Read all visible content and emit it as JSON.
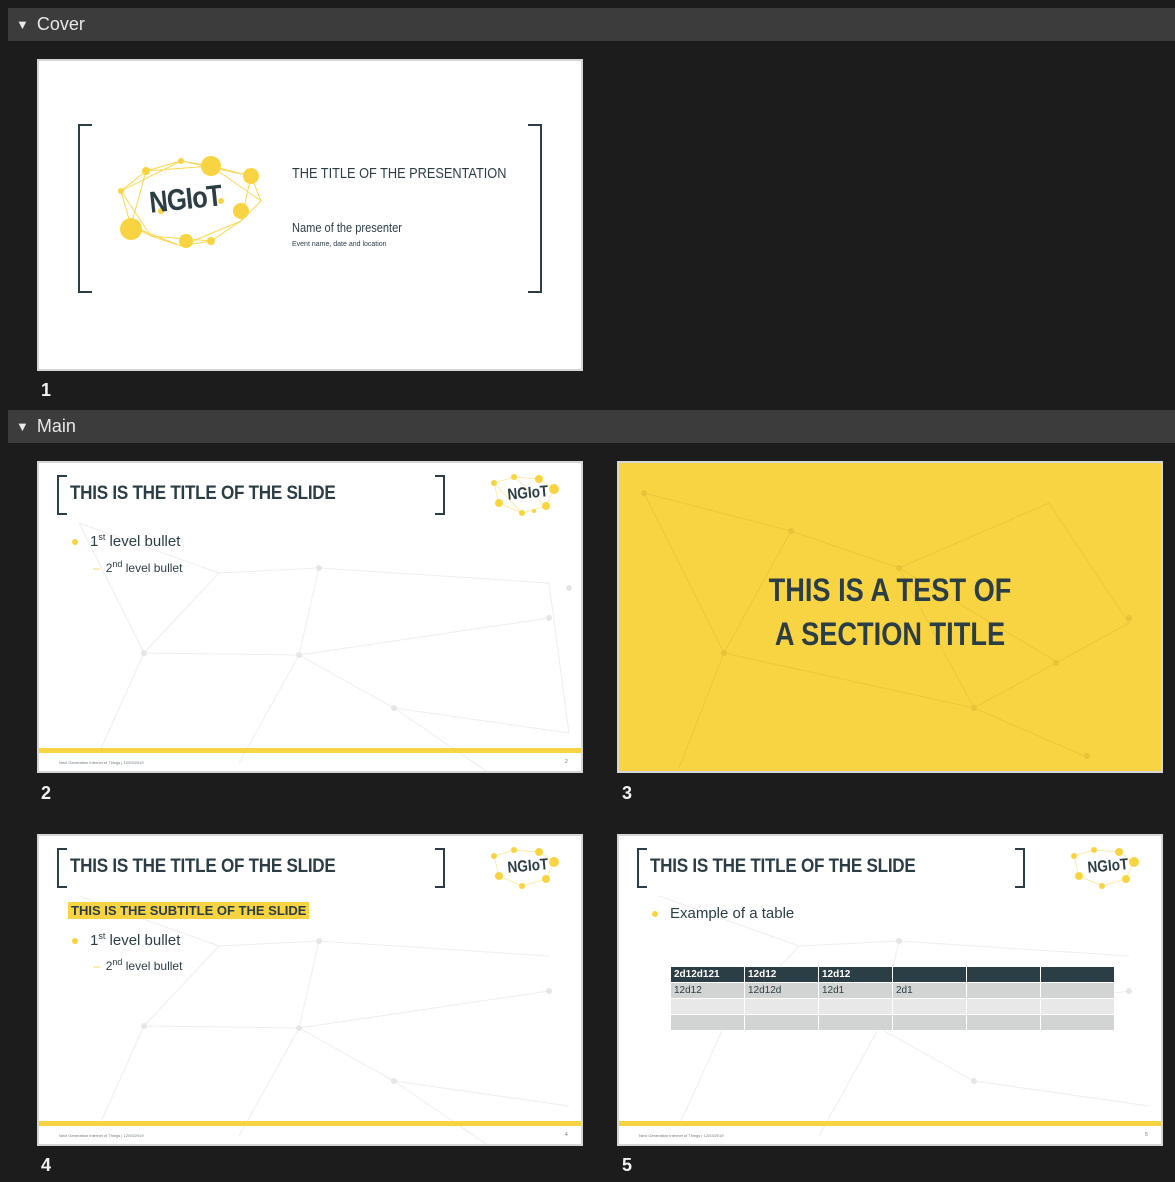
{
  "sections": [
    {
      "label": "Cover"
    },
    {
      "label": "Main"
    }
  ],
  "slides": [
    {
      "number": "1",
      "logo": "NGIoT",
      "title": "THE TITLE OF THE PRESENTATION",
      "presenter": "Name of the presenter",
      "event": "Event name, date and location"
    },
    {
      "number": "2",
      "title": "THIS IS THE TITLE OF THE SLIDE",
      "logo": "NGIoT",
      "bullet1": "1",
      "bullet1_sup": "st",
      "bullet1_text": " level bullet",
      "bullet2": "2",
      "bullet2_sup": "nd",
      "bullet2_text": " level bullet",
      "footer": "Next Generation Internet of Things   |   12/03/2019",
      "page": "2"
    },
    {
      "number": "3",
      "line1": "THIS IS A TEST OF",
      "line2": "A SECTION TITLE"
    },
    {
      "number": "4",
      "title": "THIS IS THE TITLE OF THE SLIDE",
      "subtitle": "THIS IS THE SUBTITLE OF THE SLIDE",
      "logo": "NGIoT",
      "bullet1": "1",
      "bullet1_sup": "st",
      "bullet1_text": " level bullet",
      "bullet2": "2",
      "bullet2_sup": "nd",
      "bullet2_text": " level bullet",
      "footer": "Next Generation Internet of Things   |   12/03/2019",
      "page": "4"
    },
    {
      "number": "5",
      "title": "THIS IS THE TITLE OF THE SLIDE",
      "logo": "NGIoT",
      "bullet1_text": "Example of a table",
      "table": {
        "header": [
          "2d12d121",
          "12d12",
          "12d12",
          "",
          "",
          ""
        ],
        "row1": [
          "12d12",
          "12d12d",
          "12d1",
          "2d1",
          "",
          ""
        ]
      },
      "footer": "Next Generation Internet of Things   |   12/03/2019",
      "page": "5"
    }
  ],
  "colors": {
    "accent_yellow": "#f9d442",
    "dark_teal": "#2c3e45",
    "background": "#1c1c1c",
    "section_header": "#3c3c3c"
  }
}
